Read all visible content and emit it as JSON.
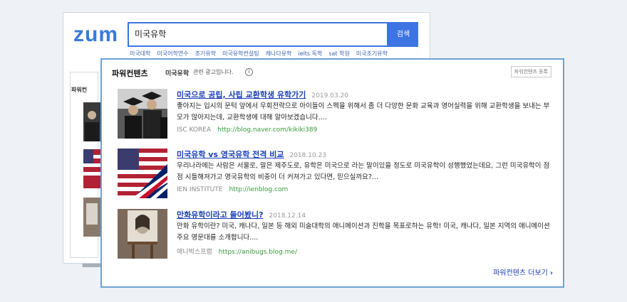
{
  "search": {
    "logo": "zum",
    "query": "미국유학",
    "button_label": "검색",
    "related": [
      "미국대학",
      "미국어학연수",
      "조기유학",
      "미국유학컨설팅",
      "캐나다유학",
      "ielts 독학",
      "sat 학원",
      "미국조기유학"
    ],
    "side_title": "파워컨"
  },
  "power": {
    "title": "파워컨텐츠",
    "query": "미국유학",
    "desc": "관련 광고입니다.",
    "info_glyph": "i",
    "register_label": "파워컨텐츠 등록",
    "more_label": "파워컨텐츠 더보기",
    "more_glyph": "›",
    "items": [
      {
        "title": "미국으로 공립, 사립 교환학생 유학가기",
        "date": "2019.03.20",
        "desc": "좋아지는 입시의 문턱 앞에서 우회전략으로 아이들이 스펙을 위해서 좀 더 다양한 문화 교육과 영어실력을 위해 교환학생을 보내는 부모가 많아지는데, 교환학생에 대해 알아보겠습니다....",
        "source": "ISC KOREA",
        "url": "http://blog.naver.com/kikiki389",
        "thumb": "graduates"
      },
      {
        "title": "미국유학 vs 영국유학 전격 비교",
        "date": "2018.10.23",
        "desc": "우리나라에는 사람은 서울로, 말은 제주도로, 유학은 미국으로 라는 말이있을 정도로 미국유학이 성행했었는데요, 그런 미국유학이 점점 시들해져가고 영국유학의 비중이 더 커져가고 있다면, 믿으실까요?...",
        "source": "IEN INSTITUTE",
        "url": "http://ienblog.com",
        "thumb": "flags"
      },
      {
        "title": "만화유학이라고 들어봤니?",
        "date": "2018.12.14",
        "desc": "만화 유학이란? 미국, 캐나다, 일본 등 해외 미술대학의 애니메이션과 진학을 목표로하는 유학! 미국, 캐나다, 일본 지역의 애니메이션 주요 명문대를 소개합니다....",
        "source": "애니벅스프랩",
        "url": "https://anibugs.blog.me/",
        "thumb": "drawing"
      }
    ]
  },
  "colors": {
    "accent": "#3d74e4",
    "link": "#1a3eb8",
    "url": "#3a9a3a",
    "frame": "#6ea0d4"
  }
}
